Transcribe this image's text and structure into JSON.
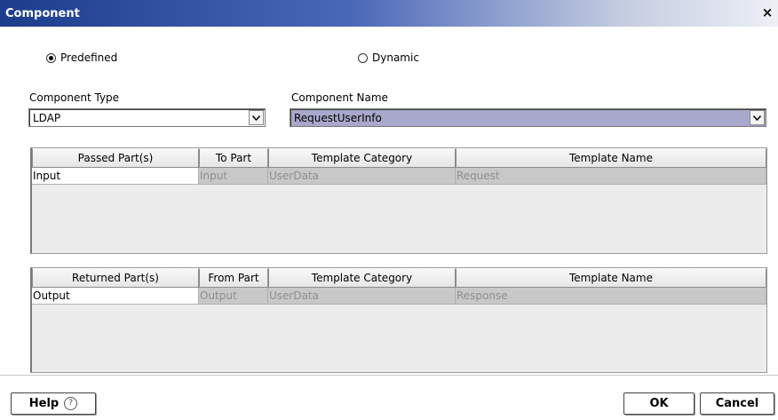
{
  "window": {
    "title": "Component",
    "close_glyph": "×"
  },
  "mode": {
    "predefined_label": "Predefined",
    "dynamic_label": "Dynamic",
    "selected": "Predefined"
  },
  "component_type": {
    "label": "Component Type",
    "value": "LDAP"
  },
  "component_name": {
    "label": "Component Name",
    "value": "RequestUserInfo",
    "highlight_color": "#a8a8cc"
  },
  "passed_table": {
    "headers": [
      "Passed Part(s)",
      "To Part",
      "Template Category",
      "Template Name"
    ],
    "rows": [
      [
        "Input",
        "Input",
        "UserData",
        "Request"
      ]
    ]
  },
  "returned_table": {
    "headers": [
      "Returned Part(s)",
      "From Part",
      "Template Category",
      "Template Name"
    ],
    "rows": [
      [
        "Output",
        "Output",
        "UserData",
        "Response"
      ]
    ]
  },
  "buttons": {
    "help": "Help",
    "help_icon": "?",
    "ok": "OK",
    "cancel": "Cancel"
  }
}
